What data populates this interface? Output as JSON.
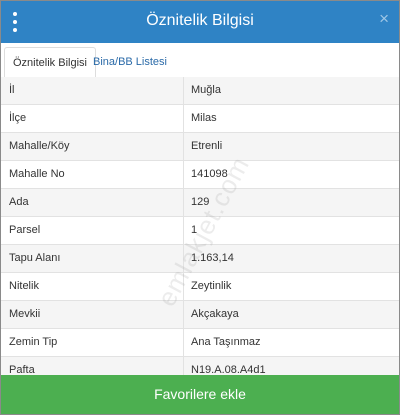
{
  "header": {
    "title": "Öznitelik Bilgisi",
    "menu_icon": "vertical-dots-icon",
    "close_icon": "close-icon",
    "close_glyph": "×"
  },
  "tabs": [
    {
      "label": "Öznitelik Bilgisi",
      "active": true
    },
    {
      "label": "Bina/BB Listesi",
      "active": false
    }
  ],
  "rows": [
    {
      "label": "İl",
      "value": "Muğla"
    },
    {
      "label": "İlçe",
      "value": "Milas"
    },
    {
      "label": "Mahalle/Köy",
      "value": "Etrenli"
    },
    {
      "label": "Mahalle No",
      "value": "141098"
    },
    {
      "label": "Ada",
      "value": "129"
    },
    {
      "label": "Parsel",
      "value": "1"
    },
    {
      "label": "Tapu Alanı",
      "value": "1.163,14"
    },
    {
      "label": "Nitelik",
      "value": "Zeytinlik"
    },
    {
      "label": "Mevkii",
      "value": "Akçakaya"
    },
    {
      "label": "Zemin Tip",
      "value": "Ana Taşınmaz"
    },
    {
      "label": "Pafta",
      "value": "N19.A.08.A4d1"
    }
  ],
  "watermark": "emlakjet.com",
  "footer": {
    "button_label": "Favorilere ekle"
  },
  "colors": {
    "header_bg": "#2f83c5",
    "button_bg": "#4caf50",
    "tab_link": "#2a6aa8",
    "row_alt": "#f5f5f5"
  }
}
